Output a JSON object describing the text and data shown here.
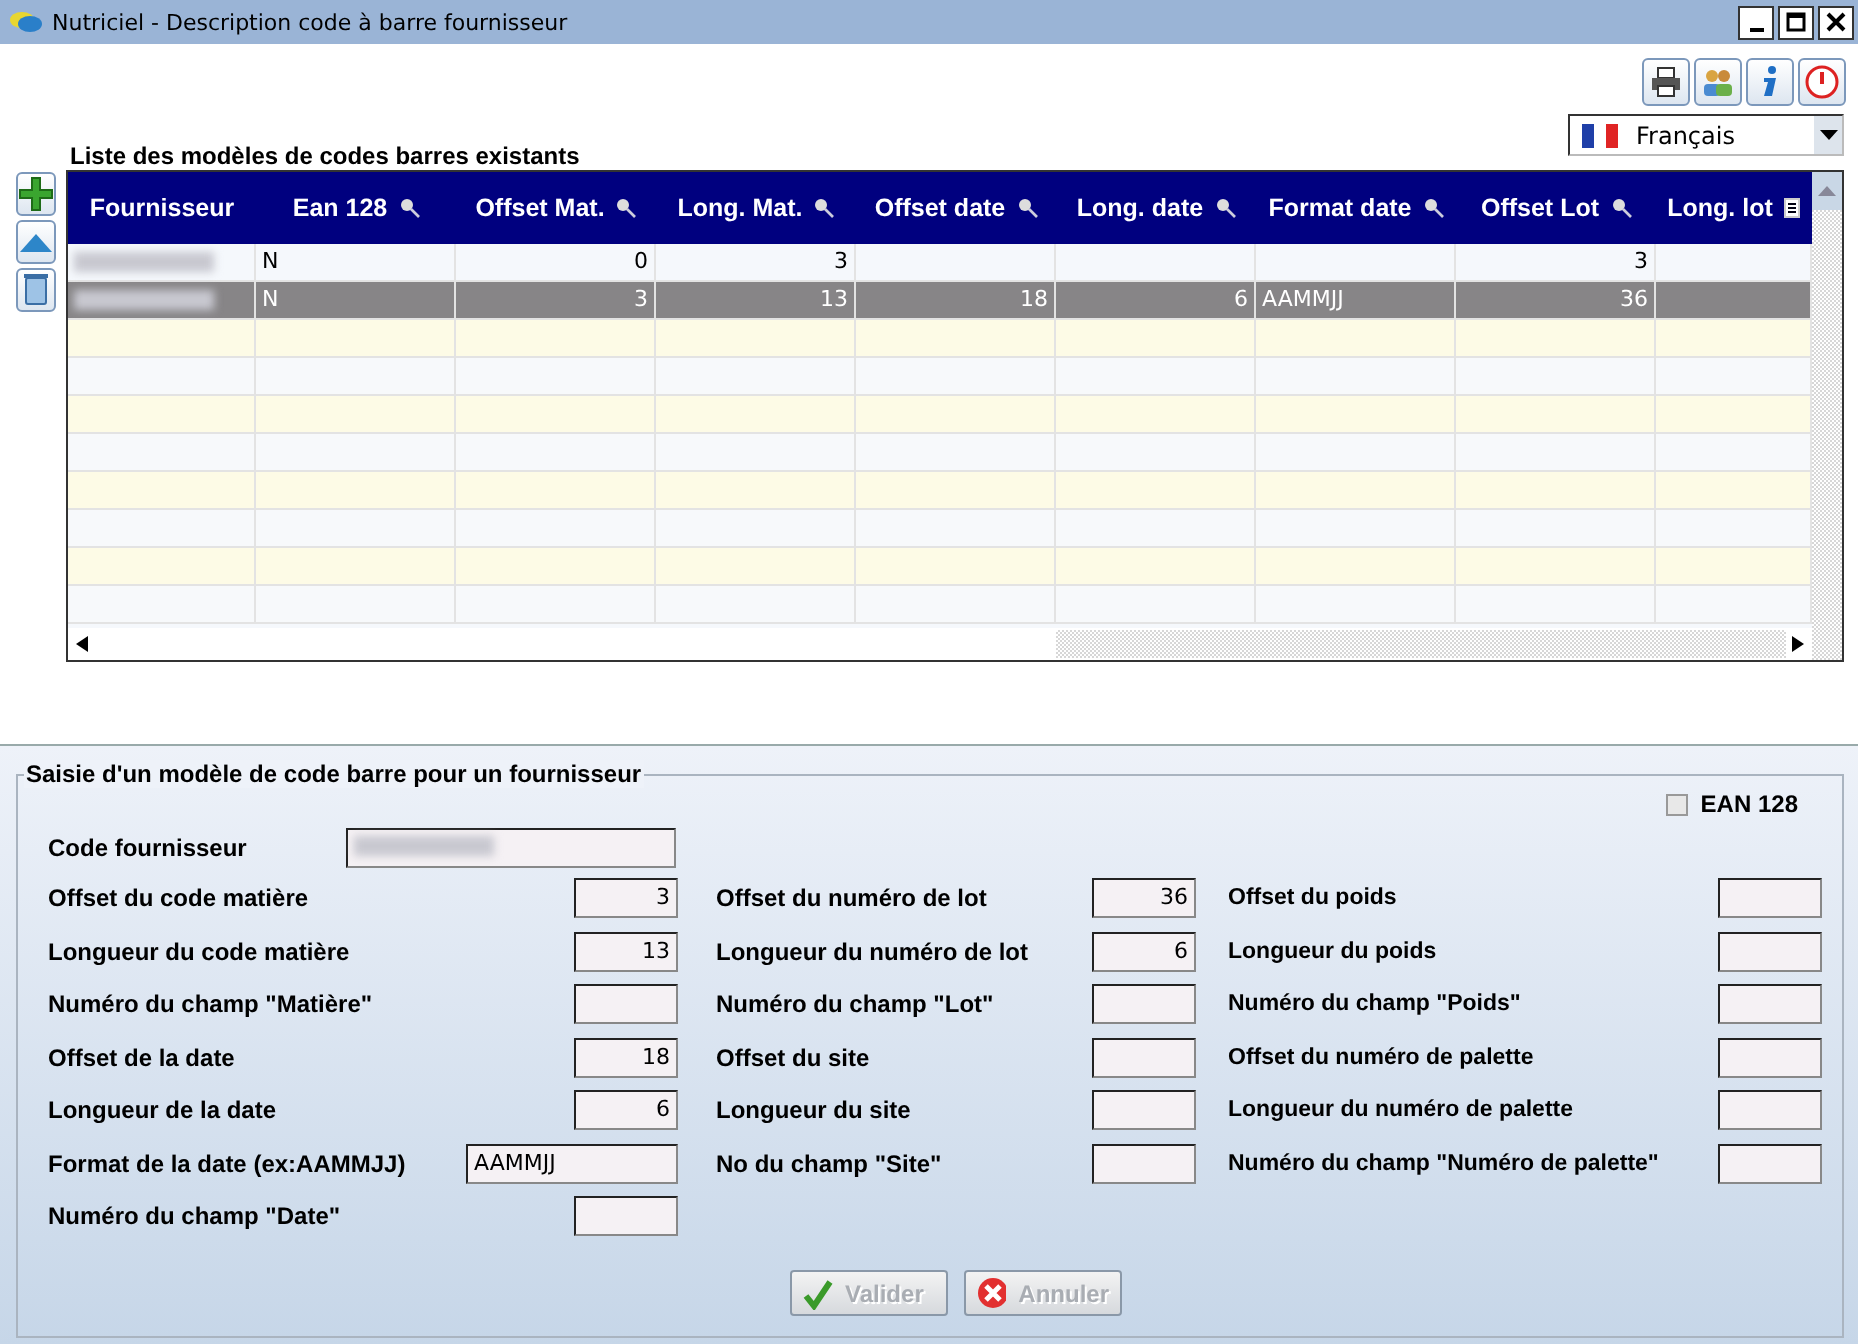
{
  "window": {
    "title": "Nutriciel - Description code à barre fournisseur"
  },
  "language": {
    "value": "Français"
  },
  "list": {
    "title": "Liste des modèles de codes barres existants",
    "columns": [
      {
        "label": "Fournisseur"
      },
      {
        "label": "Ean 128"
      },
      {
        "label": "Offset Mat."
      },
      {
        "label": "Long. Mat."
      },
      {
        "label": "Offset date"
      },
      {
        "label": "Long. date"
      },
      {
        "label": "Format date"
      },
      {
        "label": "Offset Lot"
      },
      {
        "label": "Long. lot"
      }
    ],
    "rows": [
      {
        "selected": false,
        "supplier_redacted": true,
        "cells": [
          null,
          "N",
          "0",
          "3",
          null,
          null,
          null,
          "3",
          null
        ]
      },
      {
        "selected": true,
        "supplier_redacted": true,
        "cells": [
          null,
          "N",
          "3",
          "13",
          "18",
          "6",
          "AAMMJJ",
          "36",
          null
        ]
      }
    ]
  },
  "form": {
    "title": "Saisie d'un modèle de code barre pour un fournisseur",
    "ean128": {
      "label": "EAN 128",
      "checked": false
    },
    "supplier": {
      "label": "Code fournisseur",
      "redacted": true
    },
    "columns": [
      [
        {
          "label": "Offset du code matière",
          "value": "3",
          "kind": "number"
        },
        {
          "label": "Longueur du code matière",
          "value": "13",
          "kind": "number"
        },
        {
          "label": "Numéro du champ \"Matière\"",
          "kind": "number"
        },
        {
          "label": "Offset de la date",
          "value": "18",
          "kind": "number"
        },
        {
          "label": "Longueur de la date",
          "value": "6",
          "kind": "number"
        },
        {
          "label": "Format de la date (ex:AAMMJJ)",
          "value": "AAMMJJ",
          "kind": "text"
        },
        {
          "label": "Numéro du champ \"Date\"",
          "kind": "number"
        }
      ],
      [
        {
          "label": "Offset du numéro de lot",
          "value": "36",
          "kind": "number"
        },
        {
          "label": "Longueur du numéro de lot",
          "value": "6",
          "kind": "number"
        },
        {
          "label": "Numéro du champ \"Lot\"",
          "kind": "number"
        },
        {
          "label": "Offset du site",
          "kind": "number"
        },
        {
          "label": "Longueur du site",
          "kind": "number"
        },
        {
          "label": "No du champ \"Site\"",
          "kind": "number"
        }
      ],
      [
        {
          "label": "Offset du poids",
          "kind": "number"
        },
        {
          "label": "Longueur du poids",
          "kind": "number"
        },
        {
          "label": "Numéro du champ \"Poids\"",
          "kind": "number"
        },
        {
          "label": "Offset du numéro de palette",
          "kind": "number"
        },
        {
          "label": "Longueur du numéro de palette",
          "kind": "number"
        },
        {
          "label": "Numéro du champ \"Numéro de palette\"",
          "kind": "number"
        }
      ]
    ]
  },
  "buttons": [
    {
      "label": "Valider",
      "kind": "ok",
      "disabled": true
    },
    {
      "label": "Annuler",
      "kind": "cancel",
      "disabled": true
    }
  ]
}
